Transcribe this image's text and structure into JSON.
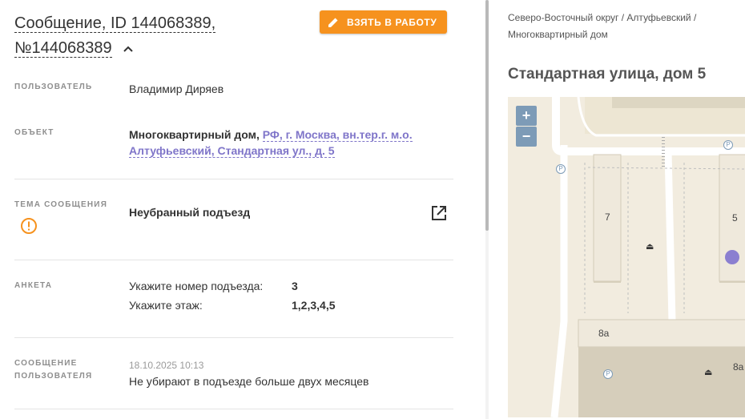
{
  "header": {
    "title": "Сообщение, ID 144068389, №144068389",
    "take_button": "ВЗЯТЬ В РАБОТУ"
  },
  "fields": {
    "user_label": "ПОЛЬЗОВАТЕЛЬ",
    "user_value": "Владимир Диряев",
    "object_label": "ОБЪЕКТ",
    "object_type": "Многоквартирный дом,",
    "object_address": "РФ, г. Москва, вн.тер.г. м.о. Алтуфьевский, Стандартная ул., д. 5",
    "topic_label": "ТЕМА СООБЩЕНИЯ",
    "topic_value": "Неубранный подъезд",
    "survey_label": "АНКЕТА",
    "survey": [
      {
        "question": "Укажите номер подъезда:",
        "answer": "3"
      },
      {
        "question": "Укажите этаж:",
        "answer": "1,2,3,4,5"
      }
    ],
    "message_label_1": "СООБЩЕНИЕ",
    "message_label_2": "ПОЛЬЗОВАТЕЛЯ",
    "message_date": "18.10.2025 10:13",
    "message_text": "Не убирают в подъезде больше двух месяцев"
  },
  "right_panel": {
    "breadcrumb_line1": "Северо-Восточный округ / Алтуфьевский /",
    "breadcrumb_line2": "Многоквартирный дом",
    "address_title": "Стандартная улица, дом 5"
  },
  "map": {
    "zoom_in": "+",
    "zoom_out": "−",
    "building_labels": [
      "7",
      "5",
      "8а",
      "8а"
    ],
    "parking_label": "P",
    "marker_color": "#8b7fd0"
  },
  "colors": {
    "accent": "#f6921e",
    "link": "#7f75c9",
    "warning": "#f6921e"
  }
}
